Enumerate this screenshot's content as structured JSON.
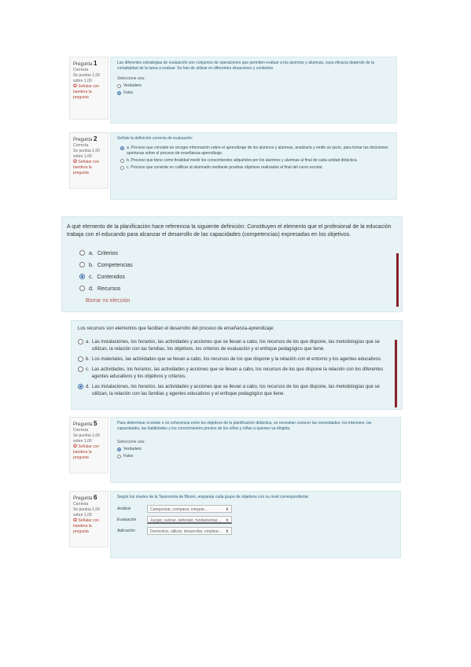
{
  "questions": {
    "q1": {
      "info": {
        "label": "Pregunta",
        "number": "1",
        "status": "Correcta",
        "score": "Se puntúa 1,00 sobre 1,00",
        "flag": "Señalar con bandera la pregunta"
      },
      "prompt": "Las diferentes estrategias de evaluación son conjuntos de operaciones que permiten evaluar a los alumnos y alumnas, cuya eficacia depende de la complejidad de la tarea a evaluar. Se han de utilizar en diferentes situaciones y contextos.",
      "select_label": "Seleccione una:",
      "options": [
        "Verdadero",
        "Falso"
      ],
      "selected": 1
    },
    "q2": {
      "info": {
        "label": "Pregunta",
        "number": "2",
        "status": "Correcta",
        "score": "Se puntúa 1,00 sobre 1,00",
        "flag": "Señalar con bandera la pregunta"
      },
      "prompt": "Señale la definición correcta de evaluación:",
      "options": [
        "a. Proceso que consiste en recoger información sobre el aprendizaje de los alumnos y alumnas, analizarla y emitir un juicio, para tomar las decisiones oportunas sobre el proceso de enseñanza-aprendizaje.",
        "b. Proceso que tiene como finalidad medir los conocimientos adquiridos por los alumnos y alumnas al final de cada unidad didáctica.",
        "c. Proceso que consiste en calificar al alumnado mediante pruebas objetivas realizadas al final del curso escolar."
      ],
      "selected": 0
    },
    "q3": {
      "prompt": "A qué elemento de la planificación hace referencia la siguiente definición: Constituyen el elemento que el profesional de la educación trabaja con el educando para alcanzar el desarrollo de las capacidades (competencias) expresadas en los objetivos.",
      "options": [
        {
          "letter": "a.",
          "text": "Criterios"
        },
        {
          "letter": "b.",
          "text": "Competencias"
        },
        {
          "letter": "c.",
          "text": "Contenidos"
        },
        {
          "letter": "d.",
          "text": "Recursos"
        }
      ],
      "selected": 2,
      "clear": "Borrar mi elección"
    },
    "q4": {
      "prompt": "Los recursos son elementos que facilitan el desarrollo del proceso de enseñanza-aprendizaje:",
      "options": [
        {
          "letter": "a.",
          "text": "Las instalaciones, los horarios, las actividades y acciones que se llevan a cabo, los recursos de los que dispone, las metodologías que se utilizan, la relación con las familias, los objetivos, los criterios de evaluación y el enfoque pedagógico que tiene."
        },
        {
          "letter": "b.",
          "text": "Los materiales, las actividades que se llevan a cabo, los recursos de los que dispone y la relación con el entorno y los agentes educativos."
        },
        {
          "letter": "c.",
          "text": "Las actividades, los horarios, las actividades y acciones que se llevan a cabo, los recursos de los que dispone la relación con los diferentes agentes educativos y los objetivos y criterios."
        },
        {
          "letter": "d.",
          "text": "Las instalaciones, los horarios, las actividades y acciones que se llevan a cabo, los recursos de los que dispone, las metodologías que se utilizan, la relación con las familias y agentes educativos y el enfoque pedagógico que tiene."
        }
      ],
      "selected": 3
    },
    "q5": {
      "info": {
        "label": "Pregunta",
        "number": "5",
        "status": "Correcta",
        "score": "Se puntúa 1,00 sobre 1,00",
        "flag": "Señalar con bandera la pregunta"
      },
      "prompt": "Para determinar si existe o no coherencia entre los objetivos de la planificación didáctica, se necesitan conocer las necesidades, los intereses, las capacidades, las habilidades y los conocimientos previos de los niños y niñas a quienes va dirigida.",
      "select_label": "Seleccione una:",
      "options": [
        "Verdadero",
        "Falso"
      ],
      "selected": 0
    },
    "q6": {
      "info": {
        "label": "Pregunta",
        "number": "6",
        "status": "Correcta",
        "score": "Se puntúa 1,00 sobre 1,00",
        "flag": "Señalar con bandera la pregunta"
      },
      "prompt": "Según los niveles de la Taxonomía de Bloom, empareja cada grupo de objetivos con su nivel correspondiente:",
      "rows": [
        {
          "label": "Análisis",
          "value": "Categorizar, comparar, integrar..."
        },
        {
          "label": "Evaluación",
          "value": "Juzgar, valorar, defender, fundamentar..."
        },
        {
          "label": "Aplicación",
          "value": "Demostrar, utilizar, desarrollar, emplear..."
        }
      ]
    }
  },
  "colors": {
    "accent": "#3b6fa8",
    "danger": "#8a1f2b",
    "panel": "#e7f3f5"
  }
}
